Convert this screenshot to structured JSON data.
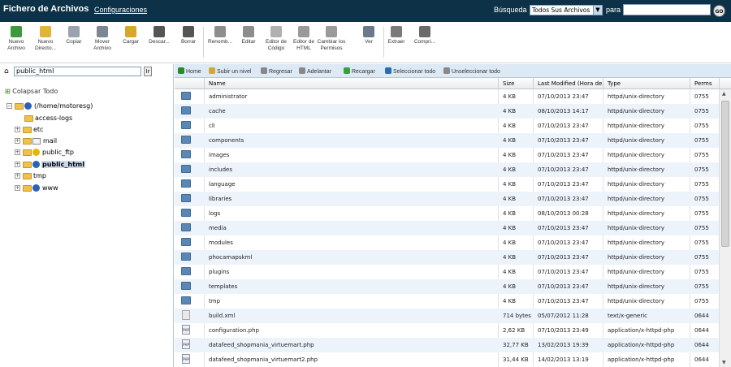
{
  "header": {
    "title": "Fichero de Archivos",
    "config_link": "Configuraciones",
    "search_label": "Búsqueda",
    "search_scope": "Todos Sus Archivos",
    "para_label": "para",
    "search_value": "",
    "go": "GO"
  },
  "toolbar": [
    {
      "label": "Nuevo Archivo",
      "icon": "new-file-icon",
      "color": "#3c9a3c"
    },
    {
      "label": "Nuevo Directo...",
      "icon": "new-folder-icon",
      "color": "#e0b43a"
    },
    {
      "label": "Copiar",
      "icon": "copy-icon",
      "color": "#9aa3ad"
    },
    {
      "label": "Mover Archivo",
      "icon": "move-icon",
      "color": "#7c8791"
    },
    {
      "label": "Cargar",
      "icon": "upload-icon",
      "color": "#d9a62c"
    },
    {
      "label": "Descar...",
      "icon": "download-icon",
      "color": "#555555"
    },
    {
      "label": "Borrar",
      "icon": "delete-icon",
      "color": "#555555"
    },
    {
      "label": "Renomb...",
      "icon": "rename-icon",
      "color": "#8d8d8d"
    },
    {
      "label": "Editar",
      "icon": "edit-icon",
      "color": "#8d8d8d"
    },
    {
      "label": "Editor de Código",
      "icon": "code-editor-icon",
      "color": "#b0b0b0"
    },
    {
      "label": "Editor de HTML",
      "icon": "html-editor-icon",
      "color": "#9a9a9a"
    },
    {
      "label": "Cambiar los Permisos",
      "icon": "permissions-icon",
      "color": "#9a9a9a"
    },
    {
      "label": "Ver",
      "icon": "view-icon",
      "color": "#6a7a8a"
    },
    {
      "label": "Extraer",
      "icon": "extract-icon",
      "color": "#7a7a7a"
    },
    {
      "label": "Compri...",
      "icon": "compress-icon",
      "color": "#6a6a6a"
    }
  ],
  "left": {
    "path": "public_html",
    "ir": "Ir",
    "collapse_all": "Colapsar Todo",
    "tree": [
      {
        "label": "(/home/motoresg)",
        "kind": "root",
        "expander": "-"
      },
      {
        "label": "access-logs",
        "kind": "folder",
        "expander": ""
      },
      {
        "label": "etc",
        "kind": "folder",
        "expander": "+"
      },
      {
        "label": "mail",
        "kind": "mail",
        "expander": "+"
      },
      {
        "label": "public_ftp",
        "kind": "ftp",
        "expander": "+"
      },
      {
        "label": "public_html",
        "kind": "web",
        "expander": "+",
        "selected": true
      },
      {
        "label": "tmp",
        "kind": "folder",
        "expander": "+"
      },
      {
        "label": "www",
        "kind": "web",
        "expander": "+"
      }
    ]
  },
  "navbar": [
    {
      "label": "Home",
      "icon": "home-icon",
      "color": "#2a8a2a"
    },
    {
      "label": "Subir un nivel",
      "icon": "up-level-icon",
      "color": "#d4a82c"
    },
    {
      "label": "Regresar",
      "icon": "back-icon",
      "color": "#888888"
    },
    {
      "label": "Adelantar",
      "icon": "forward-icon",
      "color": "#888888"
    },
    {
      "label": "Recargar",
      "icon": "reload-icon",
      "color": "#3aa03a"
    },
    {
      "label": "Seleccionar todo",
      "icon": "select-all-icon",
      "color": "#2b6cb0"
    },
    {
      "label": "Unseleccionar todo",
      "icon": "unselect-all-icon",
      "color": "#888888"
    }
  ],
  "table": {
    "columns": [
      "Name",
      "Size",
      "Last Modified (Hora de v",
      "Type",
      "Perms"
    ],
    "rows": [
      [
        "administrator",
        "4 KB",
        "07/10/2013 23:47",
        "httpd/unix-directory",
        "0755",
        "folder"
      ],
      [
        "cache",
        "4 KB",
        "08/10/2013 14:17",
        "httpd/unix-directory",
        "0755",
        "folder"
      ],
      [
        "cli",
        "4 KB",
        "07/10/2013 23:47",
        "httpd/unix-directory",
        "0755",
        "folder"
      ],
      [
        "components",
        "4 KB",
        "07/10/2013 23:47",
        "httpd/unix-directory",
        "0755",
        "folder"
      ],
      [
        "images",
        "4 KB",
        "07/10/2013 23:47",
        "httpd/unix-directory",
        "0755",
        "folder"
      ],
      [
        "includes",
        "4 KB",
        "07/10/2013 23:47",
        "httpd/unix-directory",
        "0755",
        "folder"
      ],
      [
        "language",
        "4 KB",
        "07/10/2013 23:47",
        "httpd/unix-directory",
        "0755",
        "folder"
      ],
      [
        "libraries",
        "4 KB",
        "07/10/2013 23:47",
        "httpd/unix-directory",
        "0755",
        "folder"
      ],
      [
        "logs",
        "4 KB",
        "08/10/2013 00:28",
        "httpd/unix-directory",
        "0755",
        "folder"
      ],
      [
        "media",
        "4 KB",
        "07/10/2013 23:47",
        "httpd/unix-directory",
        "0755",
        "folder"
      ],
      [
        "modules",
        "4 KB",
        "07/10/2013 23:47",
        "httpd/unix-directory",
        "0755",
        "folder"
      ],
      [
        "phocamapskml",
        "4 KB",
        "07/10/2013 23:47",
        "httpd/unix-directory",
        "0755",
        "folder"
      ],
      [
        "plugins",
        "4 KB",
        "07/10/2013 23:47",
        "httpd/unix-directory",
        "0755",
        "folder"
      ],
      [
        "templates",
        "4 KB",
        "07/10/2013 23:47",
        "httpd/unix-directory",
        "0755",
        "folder"
      ],
      [
        "tmp",
        "4 KB",
        "07/10/2013 23:47",
        "httpd/unix-directory",
        "0755",
        "folder"
      ],
      [
        "build.xml",
        "714 bytes",
        "05/07/2012 11:28",
        "text/x-generic",
        "0644",
        "file"
      ],
      [
        "configuration.php",
        "2,62 KB",
        "07/10/2013 23:49",
        "application/x-httpd-php",
        "0644",
        "php"
      ],
      [
        "datafeed_shopmania_virtuemart.php",
        "32,77 KB",
        "13/02/2013 19:39",
        "application/x-httpd-php",
        "0644",
        "php"
      ],
      [
        "datafeed_shopmania_virtuemart2.php",
        "31,44 KB",
        "14/02/2013 13:19",
        "application/x-httpd-php",
        "0644",
        "php"
      ]
    ]
  }
}
